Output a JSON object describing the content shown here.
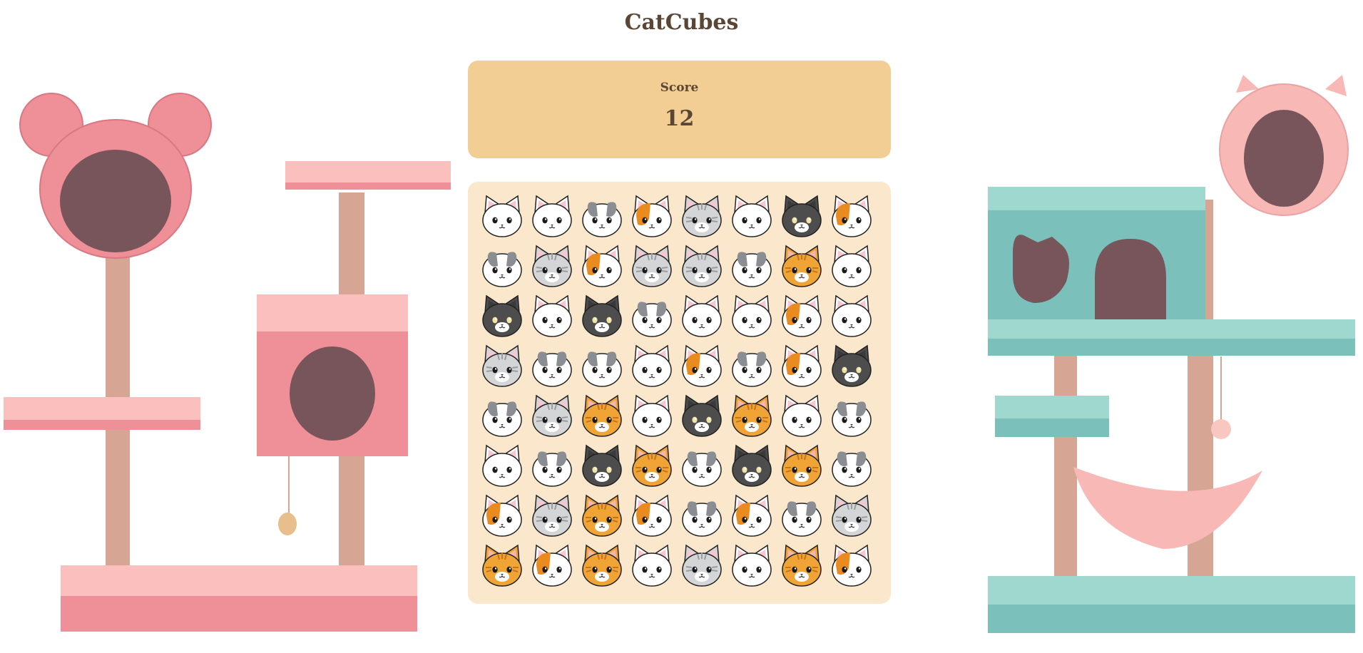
{
  "title": "CatCubes",
  "score": {
    "label": "Score",
    "value": "12"
  },
  "palette": {
    "white": {
      "fur": "#ffffff",
      "patch": null,
      "ear": "#f7c6cf"
    },
    "gray": {
      "fur": "#ffffff",
      "patch": "#8a8d92",
      "ear": "#8a8d92"
    },
    "calico": {
      "fur": "#ffffff",
      "patch": "#e98b1f",
      "ear": "#f7c6cf"
    },
    "tabby": {
      "fur": "#d4d5d7",
      "patch": "#9a9ca0",
      "ear": "#f7c6cf"
    },
    "black": {
      "fur": "#4d4d4d",
      "patch": null,
      "ear": "#3a3a3a"
    },
    "orange": {
      "fur": "#f0a436",
      "patch": "#c7751c",
      "ear": "#f3b7ae"
    }
  },
  "board": [
    [
      "white",
      "white",
      "gray",
      "calico",
      "tabby",
      "white",
      "black",
      "calico"
    ],
    [
      "gray",
      "tabby",
      "calico",
      "tabby",
      "tabby",
      "gray",
      "orange",
      "white"
    ],
    [
      "black",
      "white",
      "black",
      "gray",
      "white",
      "white",
      "calico",
      "white"
    ],
    [
      "tabby",
      "gray",
      "gray",
      "white",
      "calico",
      "gray",
      "calico",
      "black"
    ],
    [
      "gray",
      "tabby",
      "orange",
      "white",
      "black",
      "orange",
      "white",
      "gray"
    ],
    [
      "white",
      "gray",
      "black",
      "orange",
      "gray",
      "black",
      "orange",
      "gray"
    ],
    [
      "calico",
      "tabby",
      "orange",
      "calico",
      "gray",
      "calico",
      "gray",
      "tabby"
    ],
    [
      "orange",
      "calico",
      "orange",
      "white",
      "tabby",
      "white",
      "orange",
      "calico"
    ]
  ]
}
